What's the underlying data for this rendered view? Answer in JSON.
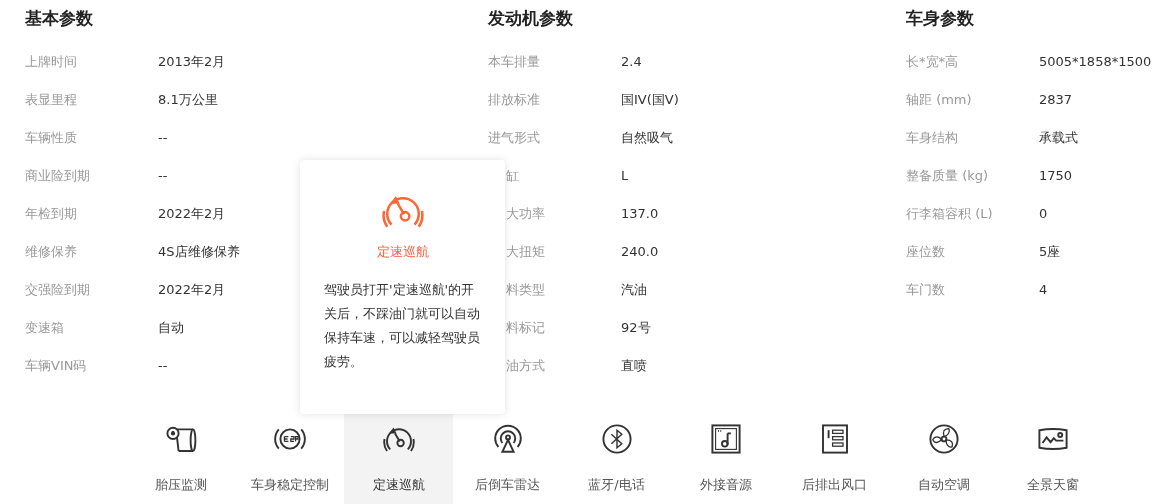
{
  "sections": [
    {
      "title": "基本参数",
      "rows": [
        {
          "label": "上牌时间",
          "value": "2013年2月",
          "covered": false
        },
        {
          "label": "表显里程",
          "value": "8.1万公里",
          "covered": false
        },
        {
          "label": "车辆性质",
          "value": "--",
          "covered": false
        },
        {
          "label": "商业险到期",
          "value": "--",
          "covered": false
        },
        {
          "label": "年检到期",
          "value": "2022年2月",
          "covered": false
        },
        {
          "label": "维修保养",
          "value": "4S店维修保养",
          "covered": false
        },
        {
          "label": "交强险到期",
          "value": "2022年2月",
          "covered": false
        },
        {
          "label": "变速箱",
          "value": "自动",
          "covered": false
        },
        {
          "label": "车辆VIN码",
          "value": "--",
          "covered": false
        }
      ]
    },
    {
      "title": "发动机参数",
      "rows": [
        {
          "label": "本车排量",
          "value": "2.4",
          "covered": false
        },
        {
          "label": "排放标准",
          "value": "国IV(国V)",
          "covered": false
        },
        {
          "label": "进气形式",
          "value": "自然吸气",
          "covered": false
        },
        {
          "label": "缸",
          "value": "L",
          "covered": true
        },
        {
          "label": "大功率",
          "value": "137.0",
          "covered": true
        },
        {
          "label": "大扭矩",
          "value": "240.0",
          "covered": true
        },
        {
          "label": "料类型",
          "value": "汽油",
          "covered": true
        },
        {
          "label": "料标记",
          "value": "92号",
          "covered": true
        },
        {
          "label": "油方式",
          "value": "直喷",
          "covered": true
        }
      ]
    },
    {
      "title": "车身参数",
      "rows": [
        {
          "label": "长*宽*高",
          "value": "5005*1858*1500",
          "covered": false
        },
        {
          "label": "轴距 (mm)",
          "value": "2837",
          "covered": false
        },
        {
          "label": "车身结构",
          "value": "承载式",
          "covered": false
        },
        {
          "label": "整备质量 (kg)",
          "value": "1750",
          "covered": false
        },
        {
          "label": "行李箱容积 (L)",
          "value": "0",
          "covered": false
        },
        {
          "label": "座位数",
          "value": "5座",
          "covered": false
        },
        {
          "label": "车门数",
          "value": "4",
          "covered": false
        }
      ]
    }
  ],
  "tooltip": {
    "title": "定速巡航",
    "text": "驾驶员打开'定速巡航'的开关后，不踩油门就可以自动保持车速，可以减轻驾驶员疲劳。"
  },
  "features": [
    {
      "kind": "tire",
      "label": "胎压监测",
      "selected": false
    },
    {
      "kind": "esp",
      "label": "车身稳定控制",
      "selected": false
    },
    {
      "kind": "cruise",
      "label": "定速巡航",
      "selected": true
    },
    {
      "kind": "radar",
      "label": "后倒车雷达",
      "selected": false
    },
    {
      "kind": "bluetooth",
      "label": "蓝牙/电话",
      "selected": false
    },
    {
      "kind": "audio",
      "label": "外接音源",
      "selected": false
    },
    {
      "kind": "vent",
      "label": "后排出风口",
      "selected": false
    },
    {
      "kind": "ac",
      "label": "自动空调",
      "selected": false
    },
    {
      "kind": "sunroof",
      "label": "全景天窗",
      "selected": false
    }
  ]
}
